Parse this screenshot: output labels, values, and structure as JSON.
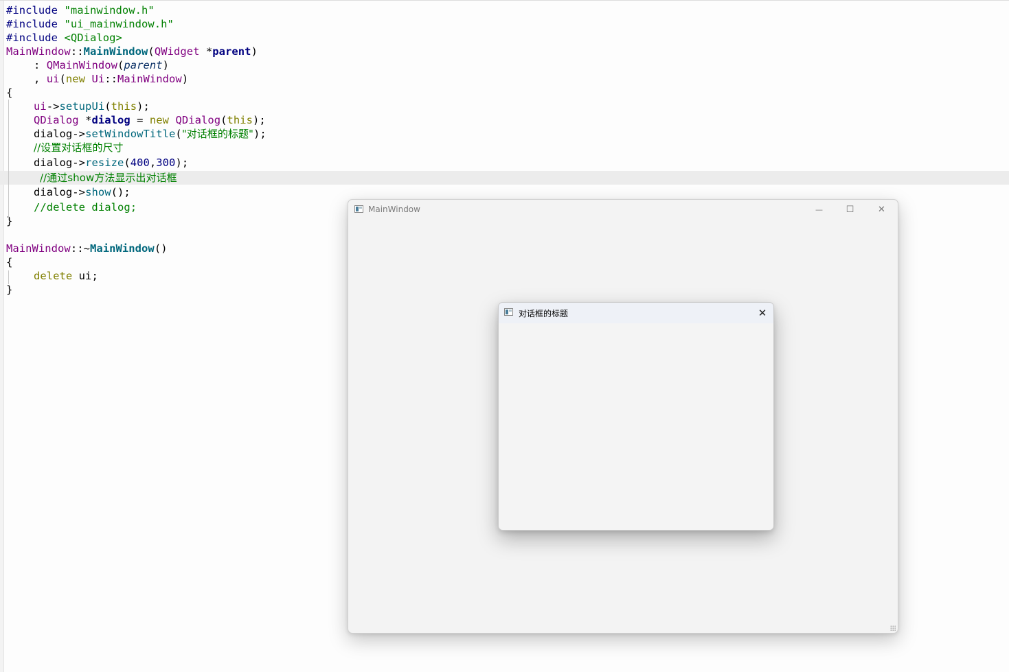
{
  "editor": {
    "l1": {
      "a": "#include ",
      "b": "\"mainwindow.h\""
    },
    "l2": {
      "a": "#include ",
      "b": "\"ui_mainwindow.h\""
    },
    "l3": {
      "a": "#include ",
      "b": "<QDialog>"
    },
    "l4": {
      "a": "MainWindow",
      "b": "::",
      "c": "MainWindow",
      "d": "(",
      "e": "QWidget",
      "f": " *",
      "g": "parent",
      "h": ")"
    },
    "l5": {
      "a": ": ",
      "b": "QMainWindow",
      "c": "(",
      "d": "parent",
      "e": ")"
    },
    "l6": {
      "a": ", ",
      "b": "ui",
      "c": "(",
      "d": "new",
      "e": " Ui",
      "f": "::",
      "g": "MainWindow",
      "h": ")"
    },
    "l7": {
      "a": "{"
    },
    "l8": {
      "a": "ui",
      "b": "->",
      "c": "setupUi",
      "d": "(",
      "e": "this",
      "f": ");"
    },
    "l9": {
      "a": "QDialog",
      "b": " *",
      "c": "dialog",
      "d": " = ",
      "e": "new",
      "f": " QDialog",
      "g": "(",
      "h": "this",
      "i": ");"
    },
    "l10": {
      "a": "dialog",
      "b": "->",
      "c": "setWindowTitle",
      "d": "(",
      "e": "\"对话框的标题\"",
      "f": ");"
    },
    "l11": {
      "a": "//设置对话框的尺寸"
    },
    "l12": {
      "a": "dialog",
      "b": "->",
      "c": "resize",
      "d": "(",
      "e": "400",
      "f": ",",
      "g": "300",
      "h": ");"
    },
    "l13": {
      "a": "//通过show方法显示出对话框"
    },
    "l14": {
      "a": "dialog",
      "b": "->",
      "c": "show",
      "d": "();"
    },
    "l15": {
      "a": "//delete dialog;"
    },
    "l16": {
      "a": "}"
    },
    "l18": {
      "a": "MainWindow",
      "b": "::~",
      "c": "MainWindow",
      "d": "()"
    },
    "l19": {
      "a": "{"
    },
    "l20": {
      "a": "delete",
      "b": " ui",
      "c": ";"
    },
    "l21": {
      "a": "}"
    }
  },
  "main_window": {
    "title": "MainWindow",
    "minimize_glyph": "—",
    "maximize_glyph": "☐",
    "close_glyph": "✕"
  },
  "dialog": {
    "title": "对话框的标题",
    "close_glyph": "✕"
  },
  "colors": {
    "keyword": "#808000",
    "string": "#008000",
    "class": "#800080",
    "function": "#00677c",
    "preprocessor": "#000080",
    "comment": "#008000",
    "current_line": "#ececec"
  }
}
